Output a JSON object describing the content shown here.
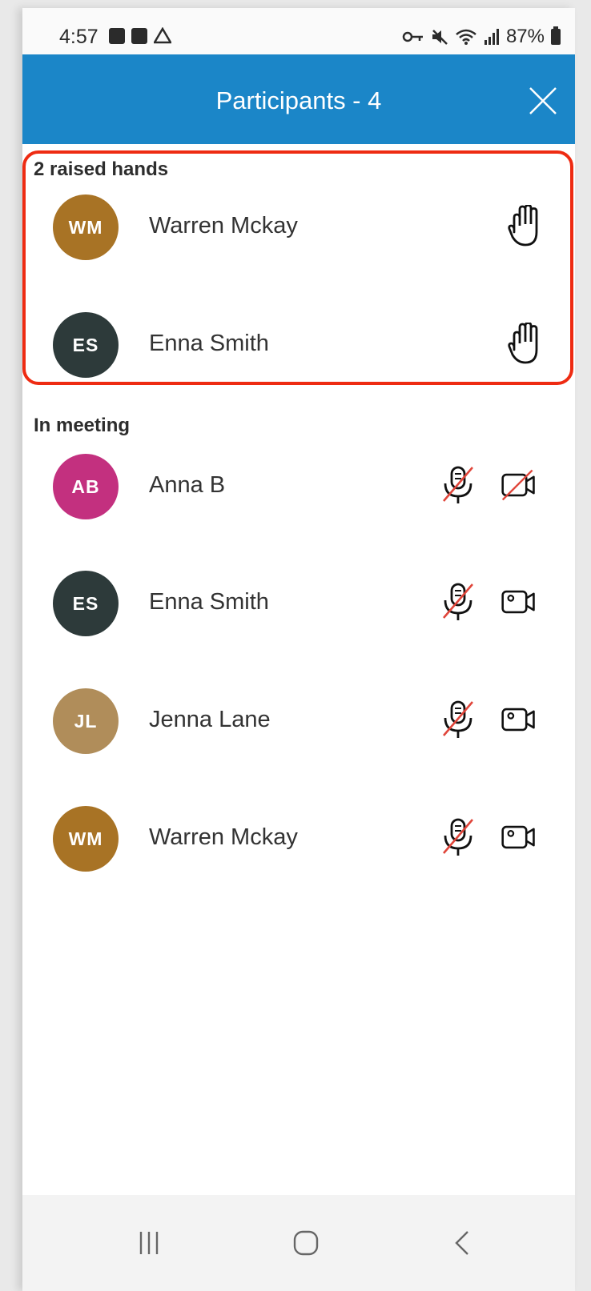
{
  "status_bar": {
    "time": "4:57",
    "battery": "87%",
    "icons": [
      "image-icon",
      "calendar-icon",
      "drive-icon",
      "key-icon",
      "mute-icon",
      "wifi-icon",
      "signal-icon",
      "battery-icon"
    ]
  },
  "header": {
    "title": "Participants - 4",
    "close_icon": "close-icon",
    "background": "#1b86c8"
  },
  "raised_hands": {
    "label": "2 raised hands",
    "highlight_color": "#ee2b12",
    "items": [
      {
        "initials": "WM",
        "name": "Warren Mckay",
        "color": "#a87325",
        "icon": "raised-hand-icon"
      },
      {
        "initials": "ES",
        "name": "Enna Smith",
        "color": "#2d3a3a",
        "icon": "raised-hand-icon"
      }
    ]
  },
  "in_meeting": {
    "label": "In meeting",
    "items": [
      {
        "initials": "AB",
        "name": "Anna B",
        "color": "#c3307f",
        "mic": "muted",
        "video": "off"
      },
      {
        "initials": "ES",
        "name": "Enna Smith",
        "color": "#2d3a3a",
        "mic": "muted",
        "video": "on"
      },
      {
        "initials": "JL",
        "name": "Jenna Lane",
        "color": "#b08d5a",
        "mic": "muted",
        "video": "on"
      },
      {
        "initials": "WM",
        "name": "Warren Mckay",
        "color": "#a87325",
        "mic": "muted",
        "video": "on"
      }
    ]
  },
  "nav_bar": {
    "icons": [
      "recent-apps-icon",
      "home-icon",
      "back-icon"
    ]
  }
}
